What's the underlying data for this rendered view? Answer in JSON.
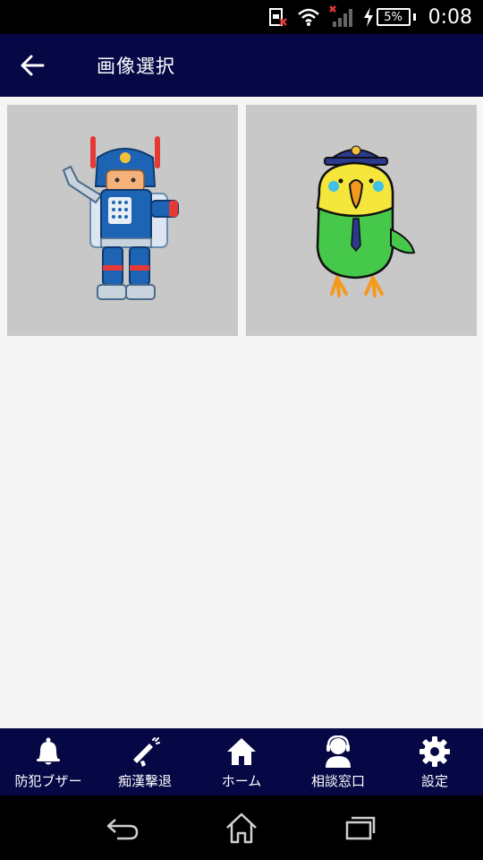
{
  "status_bar": {
    "battery_percent": "5%",
    "time": "0:08"
  },
  "app_bar": {
    "title": "画像選択"
  },
  "images": [
    {
      "icon": "robot-mascot-image"
    },
    {
      "icon": "parakeet-police-mascot-image"
    }
  ],
  "bottom_nav": {
    "items": [
      {
        "label": "防犯ブザー",
        "icon": "bell-icon"
      },
      {
        "label": "痴漢撃退",
        "icon": "megaphone-icon"
      },
      {
        "label": "ホーム",
        "icon": "home-icon"
      },
      {
        "label": "相談窓口",
        "icon": "operator-icon"
      },
      {
        "label": "設定",
        "icon": "gear-icon"
      }
    ]
  },
  "colors": {
    "app_bar": "#050845",
    "bottom_nav": "#050845",
    "tile_bg": "#c8c8c8",
    "content_bg": "#f5f5f5"
  }
}
